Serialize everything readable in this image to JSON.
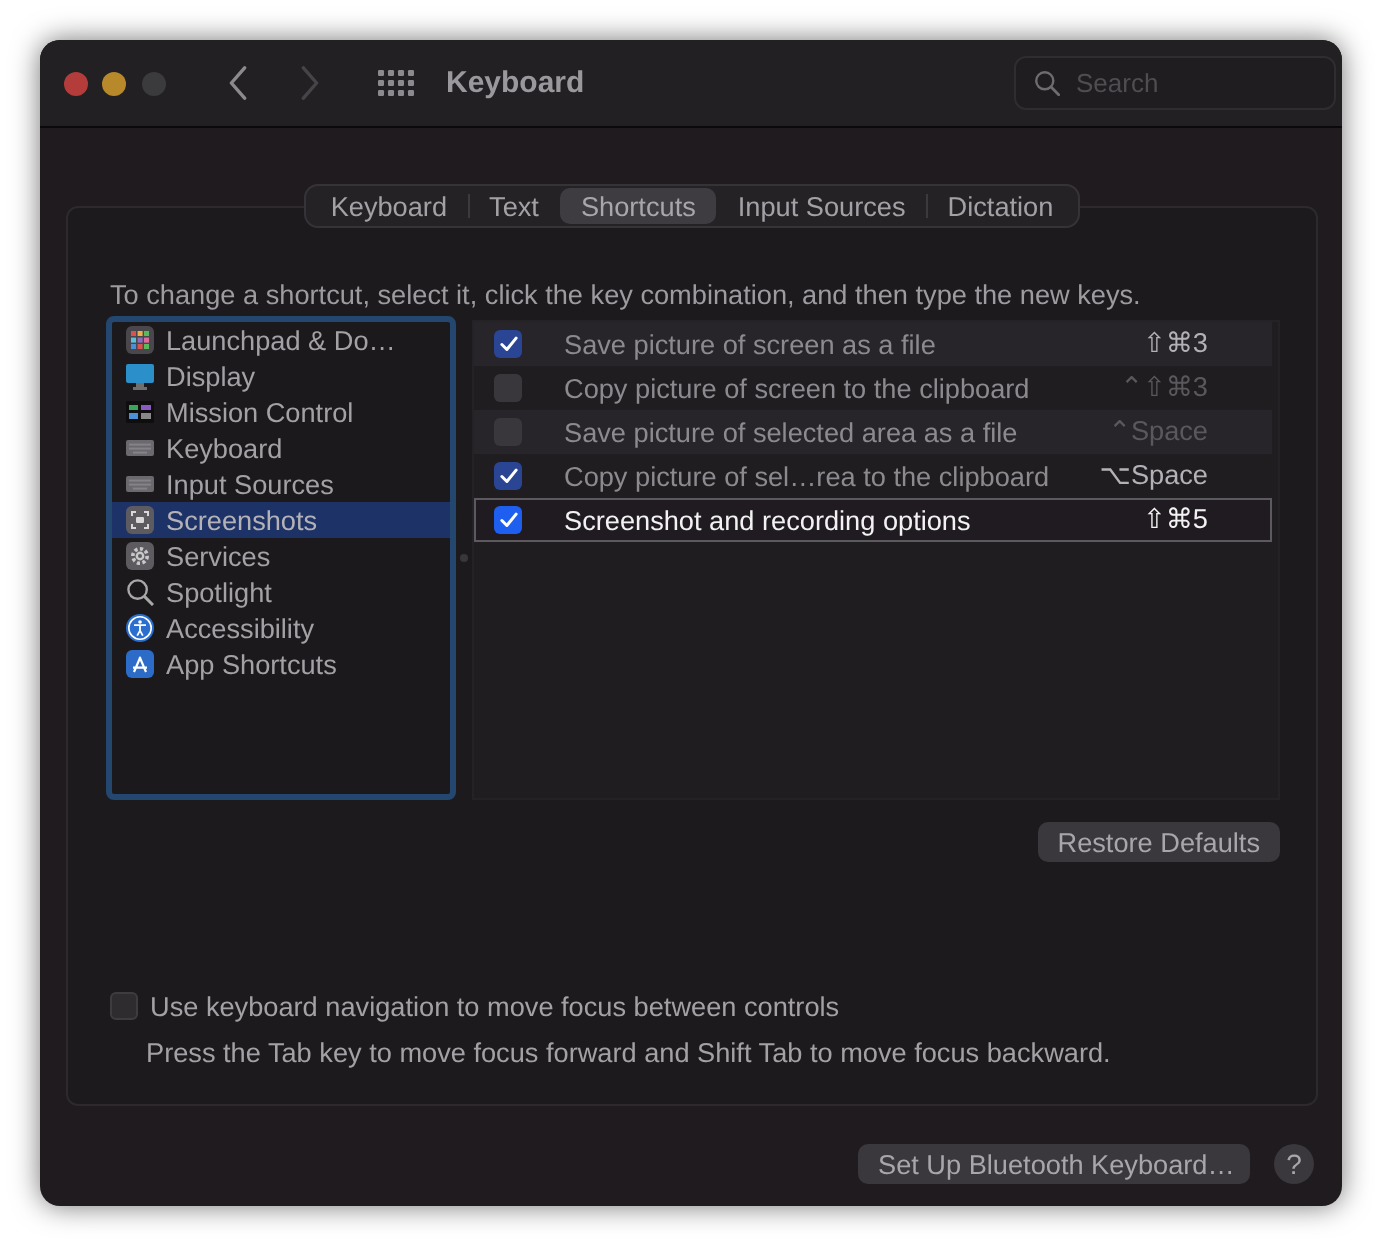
{
  "window": {
    "title": "Keyboard"
  },
  "search": {
    "placeholder": "Search"
  },
  "tabs": [
    {
      "label": "Keyboard",
      "selected": false
    },
    {
      "label": "Text",
      "selected": false
    },
    {
      "label": "Shortcuts",
      "selected": true
    },
    {
      "label": "Input Sources",
      "selected": false
    },
    {
      "label": "Dictation",
      "selected": false
    }
  ],
  "instruction": "To change a shortcut, select it, click the key combination, and then type the new keys.",
  "categories": [
    {
      "label": "Launchpad & Do…",
      "selected": false
    },
    {
      "label": "Display",
      "selected": false
    },
    {
      "label": "Mission Control",
      "selected": false
    },
    {
      "label": "Keyboard",
      "selected": false
    },
    {
      "label": "Input Sources",
      "selected": false
    },
    {
      "label": "Screenshots",
      "selected": true
    },
    {
      "label": "Services",
      "selected": false
    },
    {
      "label": "Spotlight",
      "selected": false
    },
    {
      "label": "Accessibility",
      "selected": false
    },
    {
      "label": "App Shortcuts",
      "selected": false
    }
  ],
  "shortcuts": [
    {
      "label": "Save picture of screen as a file",
      "keys": "⇧⌘3",
      "checked": true,
      "selected": false
    },
    {
      "label": "Copy picture of screen to the clipboard",
      "keys": "⌃⇧⌘3",
      "checked": false,
      "selected": false
    },
    {
      "label": "Save picture of selected area as a file",
      "keys": "⌃Space",
      "checked": false,
      "selected": false
    },
    {
      "label": "Copy picture of sel…rea to the clipboard",
      "keys": "⌥Space",
      "checked": true,
      "selected": false
    },
    {
      "label": "Screenshot and recording options",
      "keys": "⇧⌘5",
      "checked": true,
      "selected": true
    }
  ],
  "restore_button": "Restore Defaults",
  "keyboard_navigation": {
    "label": "Use keyboard navigation to move focus between controls",
    "checked": false,
    "hint": "Press the Tab key to move focus forward and Shift Tab to move focus backward."
  },
  "buttons": {
    "bluetooth": "Set Up Bluetooth Keyboard…",
    "help": "?"
  }
}
